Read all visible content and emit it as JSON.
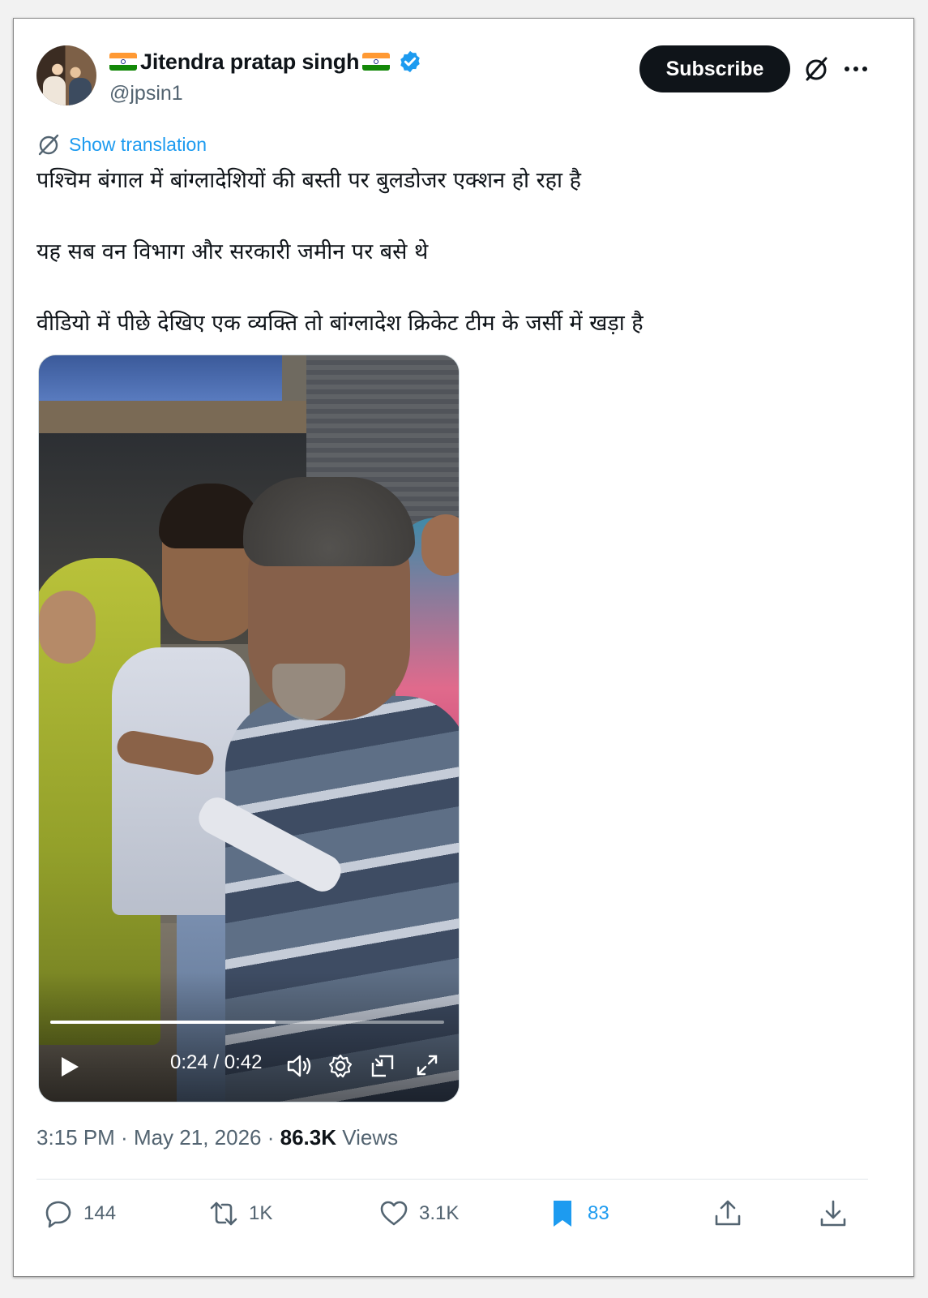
{
  "author": {
    "name": "Jitendra pratap singh",
    "handle": "@jpsin1",
    "verified": true,
    "flag_emoji": "indian-flag"
  },
  "header": {
    "subscribe_label": "Subscribe"
  },
  "tweet": {
    "translate_label": "Show translation",
    "lines": [
      "पश्चिम बंगाल में बांग्लादेशियों की बस्ती पर बुलडोजर एक्शन हो रहा है",
      "यह सब वन विभाग और सरकारी जमीन पर बसे थे",
      "वीडियो में पीछे देखिए एक व्यक्ति तो बांग्लादेश क्रिकेट टीम के जर्सी में खड़ा है"
    ]
  },
  "video": {
    "current_time": "0:24",
    "duration": "0:42",
    "time_display": "0:24 / 0:42",
    "progress_fraction": 0.571
  },
  "meta": {
    "time": "3:15 PM",
    "date": "May 21, 2026",
    "views_count": "86.3K",
    "views_label": "Views",
    "separator": " · "
  },
  "actions": {
    "replies": "144",
    "reposts": "1K",
    "likes": "3.1K",
    "bookmarks": "83"
  },
  "colors": {
    "accent": "#1d9bf0",
    "text_primary": "#0f1419",
    "text_secondary": "#536471",
    "subscribe_bg": "#0f1419"
  }
}
